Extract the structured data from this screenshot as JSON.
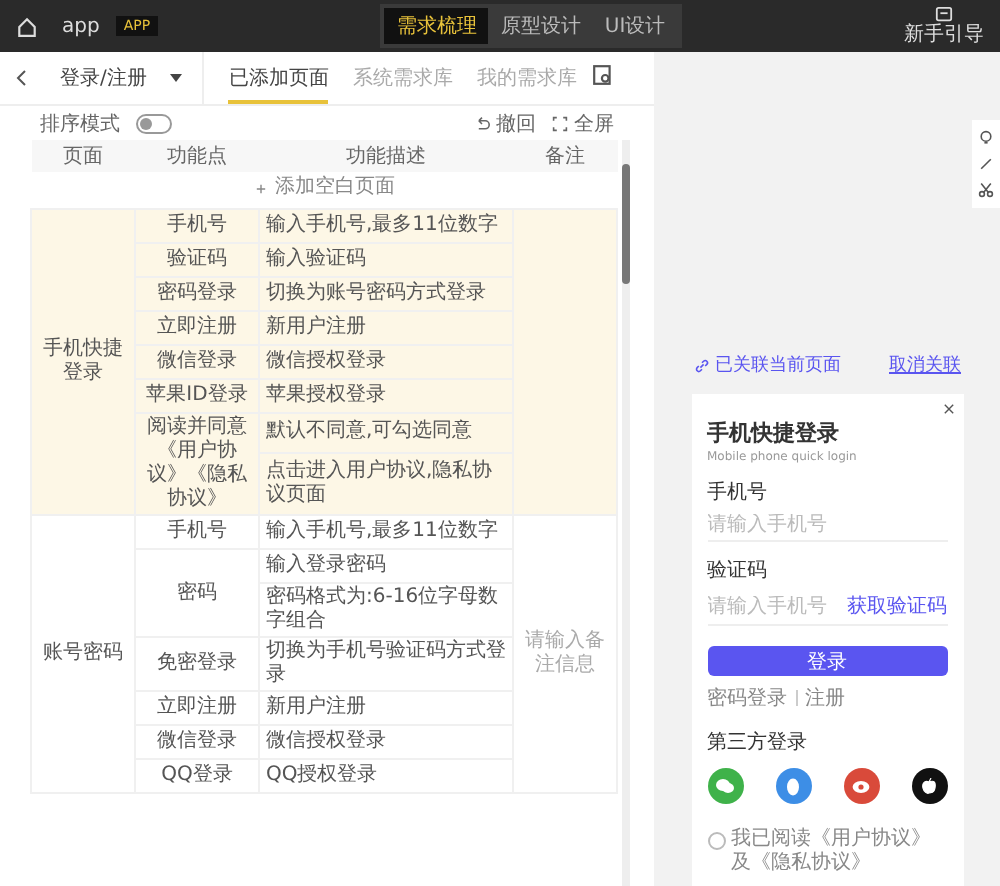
{
  "top_bar": {
    "app_name": "app",
    "badge": "APP",
    "tabs": [
      {
        "label": "需求梳理",
        "selected": true
      },
      {
        "label": "原型设计",
        "selected": false
      },
      {
        "label": "UI设计",
        "selected": false
      }
    ],
    "guide": "新手引导"
  },
  "page_bar": {
    "page_select": "登录/注册",
    "tabs": [
      {
        "label": "已添加页面",
        "selected": true
      },
      {
        "label": "系统需求库",
        "selected": false
      },
      {
        "label": "我的需求库",
        "selected": false
      }
    ]
  },
  "toolbar": {
    "sort_mode": {
      "label": "排序模式",
      "on": false
    },
    "undo": "撤回",
    "fullscreen": "全屏"
  },
  "table": {
    "columns": [
      "页面",
      "功能点",
      "功能描述",
      "备注"
    ],
    "add_row": "添加空白页面",
    "groups": [
      {
        "page": "手机快捷登录",
        "highlighted": true,
        "features": [
          {
            "kind": "item",
            "name": "手机号",
            "descriptions": [
              "输入手机号,最多11位数字"
            ]
          },
          {
            "kind": "item",
            "name": "验证码",
            "descriptions": [
              "输入验证码"
            ]
          },
          {
            "kind": "item",
            "name": "密码登录",
            "descriptions": [
              "切换为账号密码方式登录"
            ]
          },
          {
            "kind": "item",
            "name": "立即注册",
            "descriptions": [
              "新用户注册"
            ]
          },
          {
            "kind": "item",
            "name": "微信登录",
            "descriptions": [
              "微信授权登录"
            ]
          },
          {
            "kind": "item",
            "name": "苹果ID登录",
            "descriptions": [
              "苹果授权登录"
            ]
          },
          {
            "kind": "item",
            "name": "阅读并同意《用户协议》《隐私协议》",
            "descriptions": [
              "默认不同意,可勾选同意",
              "点击进入用户协议,隐私协议页面"
            ]
          }
        ]
      },
      {
        "page": "账号密码",
        "highlighted": false,
        "remark": "请输入备注信息",
        "features": [
          {
            "kind": "item",
            "name": "手机号",
            "descriptions": [
              "输入手机号,最多11位数字"
            ]
          },
          {
            "kind": "item",
            "name": "密码",
            "descriptions": [
              "输入登录密码",
              "密码格式为:6-16位字母数字组合"
            ]
          },
          {
            "kind": "item",
            "name": "免密登录",
            "descriptions": [
              "切换为手机号验证码方式登录"
            ]
          },
          {
            "kind": "item",
            "name": "立即注册",
            "descriptions": [
              "新用户注册"
            ]
          },
          {
            "kind": "item",
            "name": "微信登录",
            "descriptions": [
              "微信授权登录"
            ]
          },
          {
            "kind": "item",
            "name": "QQ登录",
            "descriptions": [
              "QQ授权登录"
            ]
          }
        ]
      }
    ]
  },
  "preview": {
    "link_status": "已关联当前页面",
    "unlink": "取消关联",
    "title": "手机快捷登录",
    "subtitle": "Mobile phone quick login",
    "fields": [
      {
        "label": "手机号",
        "placeholder": "请输入手机号"
      },
      {
        "label": "验证码",
        "placeholder": "请输入手机号",
        "action": "获取验证码"
      }
    ],
    "login_button": "登录",
    "links": [
      "密码登录",
      "注册"
    ],
    "third_party_label": "第三方登录",
    "providers": [
      {
        "kind": "chat",
        "color": "#3fb24a"
      },
      {
        "kind": "penguin",
        "color": "#3d8ee6"
      },
      {
        "kind": "eye",
        "color": "#d94a3a"
      },
      {
        "kind": "apple",
        "color": "#111111"
      }
    ],
    "consent": {
      "checked": false,
      "text": "我已阅读《用户协议》及《隐私协议》"
    }
  }
}
